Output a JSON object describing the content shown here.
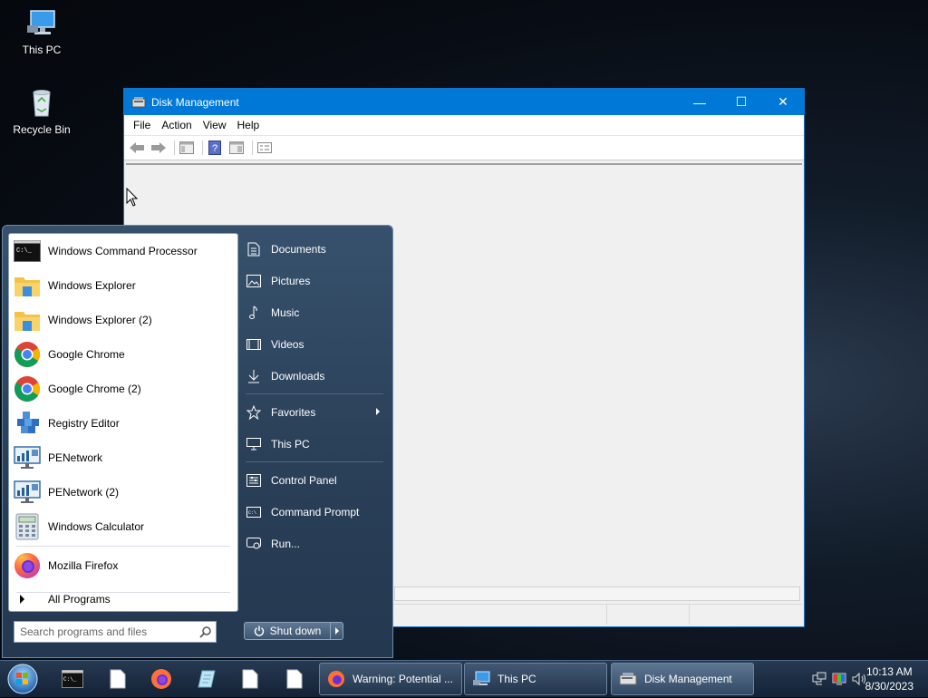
{
  "desktop": {
    "icons": [
      {
        "label": "This PC",
        "icon": "monitor-icon"
      },
      {
        "label": "Recycle Bin",
        "icon": "recycle-bin-icon"
      }
    ]
  },
  "window": {
    "title": "Disk Management",
    "controls": {
      "minimize": "—",
      "maximize": "☐",
      "close": "✕"
    },
    "menu": [
      "File",
      "Action",
      "View",
      "Help"
    ],
    "toolbar": [
      "back-icon",
      "forward-icon",
      "console-tree-icon",
      "help-icon",
      "properties-icon",
      "checklist-icon"
    ]
  },
  "start_menu": {
    "programs": [
      {
        "label": "Windows Command Processor",
        "icon": "command-prompt-icon"
      },
      {
        "label": "Windows Explorer",
        "icon": "folder-icon"
      },
      {
        "label": "Windows Explorer (2)",
        "icon": "folder-icon"
      },
      {
        "label": "Google Chrome",
        "icon": "chrome-icon"
      },
      {
        "label": "Google Chrome (2)",
        "icon": "chrome-icon"
      },
      {
        "label": "Registry Editor",
        "icon": "registry-editor-icon"
      },
      {
        "label": "PENetwork",
        "icon": "network-icon"
      },
      {
        "label": "PENetwork (2)",
        "icon": "network-icon"
      },
      {
        "label": "Windows Calculator",
        "icon": "calculator-icon"
      },
      {
        "label": "Mozilla Firefox",
        "icon": "firefox-icon"
      }
    ],
    "all_programs": "All Programs",
    "search_placeholder": "Search programs and files",
    "right": [
      {
        "label": "Documents",
        "icon": "document-icon"
      },
      {
        "label": "Pictures",
        "icon": "pictures-icon"
      },
      {
        "label": "Music",
        "icon": "music-icon"
      },
      {
        "label": "Videos",
        "icon": "videos-icon"
      },
      {
        "label": "Downloads",
        "icon": "download-icon"
      },
      {
        "label": "Favorites",
        "icon": "star-icon"
      },
      {
        "label": "This PC",
        "icon": "monitor-icon"
      },
      {
        "label": "Control Panel",
        "icon": "control-panel-icon"
      },
      {
        "label": "Command Prompt",
        "icon": "command-prompt-icon"
      },
      {
        "label": "Run...",
        "icon": "run-icon"
      }
    ],
    "shutdown": "Shut down"
  },
  "taskbar": {
    "tasks": [
      {
        "label": "Warning: Potential ...",
        "icon": "firefox-icon"
      },
      {
        "label": "This PC",
        "icon": "monitor-icon"
      },
      {
        "label": "Disk Management",
        "icon": "disk-management-icon"
      }
    ],
    "time": "10:13 AM",
    "date": "8/30/2023"
  }
}
